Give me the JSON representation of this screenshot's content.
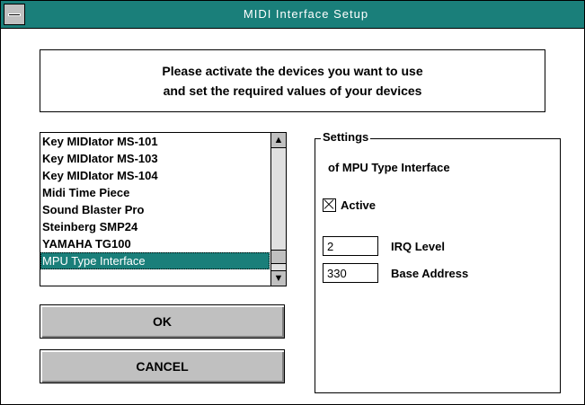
{
  "window": {
    "title": "MIDI Interface Setup"
  },
  "instruction": {
    "line1": "Please activate the devices you want to use",
    "line2": "and set the required values of your devices"
  },
  "device_list": {
    "items": [
      "Key MIDIator MS-101",
      "Key MIDIator MS-103",
      "Key MIDIator MS-104",
      "Midi Time Piece",
      "Sound Blaster Pro",
      "Steinberg SMP24",
      "YAMAHA TG100",
      "MPU Type Interface"
    ],
    "selected_index": 7
  },
  "buttons": {
    "ok_label": "OK",
    "cancel_label": "CANCEL"
  },
  "settings": {
    "group_label": "Settings",
    "device_line": "of  MPU Type Interface",
    "active_label": "Active",
    "active_checked": true,
    "irq_value": "2",
    "irq_label": "IRQ Level",
    "base_value": "330",
    "base_label": "Base Address"
  },
  "colors": {
    "titlebar": "#1a7f7a",
    "selection": "#1a7f7a",
    "button_face": "#c0c0c0"
  }
}
